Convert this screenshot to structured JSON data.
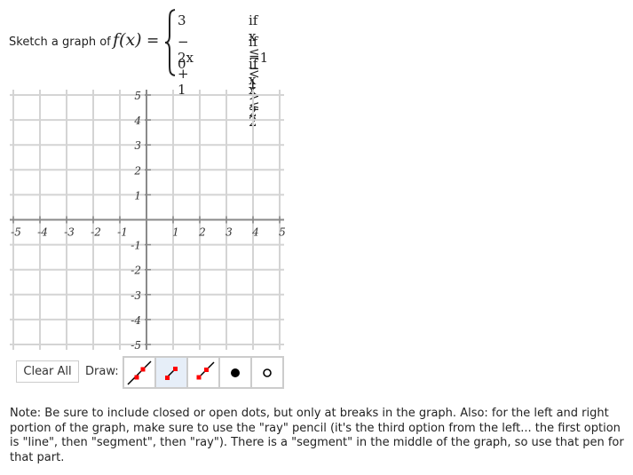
{
  "prompt": {
    "text": "Sketch a graph of",
    "function_name": "f(x)",
    "equals": "=",
    "cases": [
      {
        "expression": "3",
        "condition": "if  x ≤ − 1"
      },
      {
        "expression": "− 2x + 1",
        "condition": "if  −1 < x ≤ 2"
      },
      {
        "expression": "0",
        "condition": "if  x > 2"
      }
    ]
  },
  "graph": {
    "x_range": [
      -5,
      5
    ],
    "y_range": [
      -5,
      5
    ],
    "x_tick_labels": [
      "-5",
      "-4",
      "-3",
      "-2",
      "-1",
      "1",
      "2",
      "3",
      "4",
      "5"
    ],
    "y_tick_labels": [
      "5",
      "4",
      "3",
      "2",
      "1",
      "-1",
      "-2",
      "-3",
      "-4",
      "-5"
    ],
    "colors": {
      "grid": "#d4d4d4",
      "axis": "#8a8a8a",
      "label": "#333333"
    }
  },
  "toolbar": {
    "clear_label": "Clear All",
    "draw_label": "Draw:",
    "tools": [
      {
        "name": "line",
        "icon": "line-icon",
        "active": false
      },
      {
        "name": "segment",
        "icon": "segment-icon",
        "active": true
      },
      {
        "name": "ray",
        "icon": "ray-icon",
        "active": false
      },
      {
        "name": "closed-dot",
        "icon": "closed-dot-icon",
        "active": false
      },
      {
        "name": "open-dot",
        "icon": "open-dot-icon",
        "active": false
      }
    ],
    "colors": {
      "endpoint": "#ff0000",
      "active_bg": "#e6eef8"
    }
  },
  "note": "Note: Be sure to include closed or open dots, but only at breaks in the graph. Also: for the left and right portion of the graph, make sure to use the \"ray\" pencil (it's the third option from the left... the first option is \"line\", then \"segment\", then \"ray\"). There is a \"segment\" in the middle of the graph, so use that pen for that part."
}
